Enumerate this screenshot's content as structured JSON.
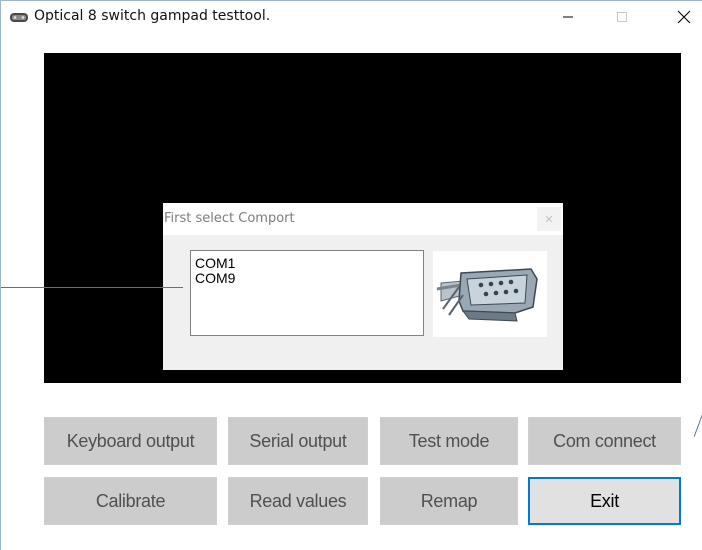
{
  "window": {
    "title": "Optical 8 switch gampad testtool.",
    "icon": "gamepad-icon"
  },
  "dialog": {
    "title": "First select Comport",
    "comports": [
      "COM1",
      "COM9"
    ],
    "image": "serial-connector-icon"
  },
  "buttons": {
    "keyboard_output": "Keyboard output",
    "serial_output": "Serial output",
    "test_mode": "Test mode",
    "com_connect": "Com connect",
    "calibrate": "Calibrate",
    "read_values": "Read values",
    "remap": "Remap",
    "exit": "Exit"
  },
  "colors": {
    "accent": "#0078d7",
    "disabled_button": "#cccccc",
    "screen": "#000000"
  }
}
